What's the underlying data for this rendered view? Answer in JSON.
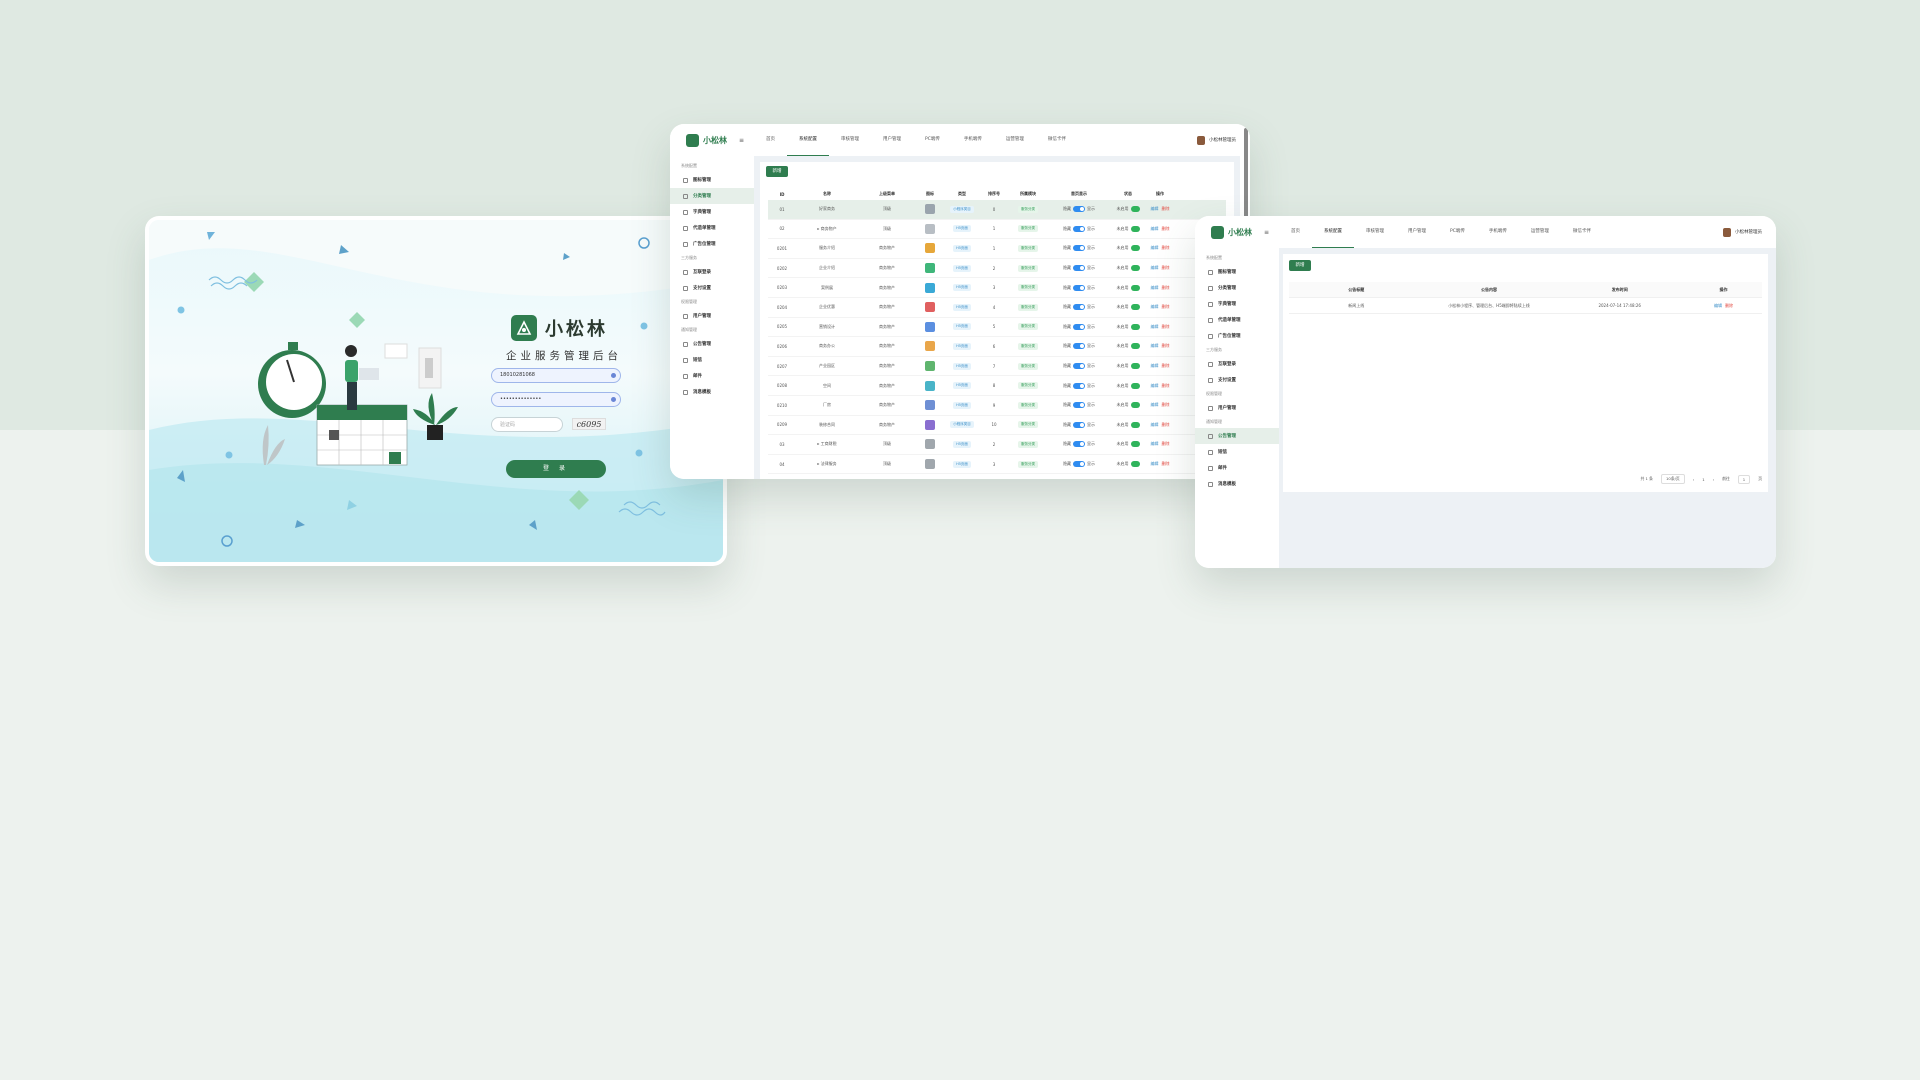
{
  "login": {
    "brand_name": "小松林",
    "subtitle": "企业服务管理后台",
    "username": "18010281068",
    "password": "••••••••••••••",
    "captcha_placeholder": "验证码",
    "captcha_code": "c6095",
    "login_label": "登 录"
  },
  "admin": {
    "brand_name": "小松林",
    "nav_tabs": [
      "首页",
      "系统配置",
      "审核管理",
      "用户管理",
      "PC端传",
      "手机端传",
      "运营管理",
      "微信卡伴"
    ],
    "active_tab_index": 1,
    "user_name": "小松林管理员",
    "sidebar": [
      {
        "type": "group",
        "label": "系统配置"
      },
      {
        "type": "item",
        "label": "图标管理"
      },
      {
        "type": "item",
        "label": "分类管理"
      },
      {
        "type": "item",
        "label": "字典管理"
      },
      {
        "type": "item",
        "label": "代造单管理"
      },
      {
        "type": "item",
        "label": "广告位管理"
      },
      {
        "type": "group",
        "label": "三方服务"
      },
      {
        "type": "item",
        "label": "互联登录"
      },
      {
        "type": "item",
        "label": "支付设置"
      },
      {
        "type": "group",
        "label": "权限管理"
      },
      {
        "type": "item",
        "label": "用户管理"
      },
      {
        "type": "group",
        "label": "通知管理"
      },
      {
        "type": "item",
        "label": "公告管理"
      },
      {
        "type": "item",
        "label": "短信"
      },
      {
        "type": "item",
        "label": "邮件"
      },
      {
        "type": "item",
        "label": "消息模板"
      }
    ]
  },
  "category_table": {
    "active_sidebar": "分类管理",
    "add_label": "新增",
    "columns": [
      "ID",
      "名称",
      "上级菜单",
      "图标",
      "类型",
      "排序号",
      "所属模块",
      "首页显示",
      "状态",
      "操作"
    ],
    "show_on": "隐藏",
    "show_off": "显示",
    "status_text": "未启用",
    "edit_label": "编辑",
    "delete_label": "删除",
    "rows": [
      {
        "id": "01",
        "name": "好家商务",
        "parent": "顶级",
        "type": "小程序类目",
        "sort": "0",
        "module": "服务分类",
        "color": "#9aa4ad",
        "selected": true
      },
      {
        "id": "02",
        "name": "▸ 商务物产",
        "parent": "顶级",
        "type": "H5页面",
        "sort": "1",
        "module": "服务分类",
        "color": "#b8bec4"
      },
      {
        "id": "0201",
        "name": "服务介绍",
        "parent": "商务物产",
        "type": "H5页面",
        "sort": "1",
        "module": "服务分类",
        "color": "#e6a73a"
      },
      {
        "id": "0202",
        "name": "企业介绍",
        "parent": "商务物产",
        "type": "H5页面",
        "sort": "2",
        "module": "服务分类",
        "color": "#3fb67a"
      },
      {
        "id": "0203",
        "name": "案例展",
        "parent": "商务物产",
        "type": "H5页面",
        "sort": "3",
        "module": "服务分类",
        "color": "#3aa9d6"
      },
      {
        "id": "0204",
        "name": "企业优惠",
        "parent": "商务物产",
        "type": "H5页面",
        "sort": "4",
        "module": "服务分类",
        "color": "#e06060"
      },
      {
        "id": "0205",
        "name": "营销设计",
        "parent": "商务物产",
        "type": "H5页面",
        "sort": "5",
        "module": "服务分类",
        "color": "#5b8fe0"
      },
      {
        "id": "0206",
        "name": "商务办公",
        "parent": "商务物产",
        "type": "H5页面",
        "sort": "6",
        "module": "服务分类",
        "color": "#e9a64a"
      },
      {
        "id": "0207",
        "name": "产业园区",
        "parent": "商务物产",
        "type": "H5页面",
        "sort": "7",
        "module": "服务分类",
        "color": "#5fb56e"
      },
      {
        "id": "0208",
        "name": "空间",
        "parent": "商务物产",
        "type": "H5页面",
        "sort": "8",
        "module": "服务分类",
        "color": "#49b4c8"
      },
      {
        "id": "0210",
        "name": "厂房",
        "parent": "商务物产",
        "type": "H5页面",
        "sort": "9",
        "module": "服务分类",
        "color": "#6f8fd4"
      },
      {
        "id": "0209",
        "name": "装修合同",
        "parent": "商务物产",
        "type": "小程序类目",
        "sort": "10",
        "module": "服务分类",
        "color": "#8a6fd0"
      },
      {
        "id": "03",
        "name": "▸ 工商财税",
        "parent": "顶级",
        "type": "H5页面",
        "sort": "2",
        "module": "服务分类",
        "color": "#a0a7ad"
      },
      {
        "id": "04",
        "name": "▸ 法律服务",
        "parent": "顶级",
        "type": "H5页面",
        "sort": "3",
        "module": "服务分类",
        "color": "#a0a7ad"
      }
    ]
  },
  "notice_table": {
    "active_sidebar": "公告管理",
    "add_label": "新增",
    "columns": [
      "公告标题",
      "公告内容",
      "发布时间",
      "操作"
    ],
    "rows": [
      {
        "title": "新闻上线",
        "content": "小松林小程序、管理后台、H5端即将陆续上线",
        "time": "2024-07-14 17:48:26",
        "edit": "编辑",
        "delete": "删除"
      }
    ],
    "pager": {
      "total": "共 1 条",
      "page_size": "10条/页",
      "current": "1",
      "goto_label": "前往",
      "goto_page": "1",
      "page_unit": "页"
    }
  }
}
